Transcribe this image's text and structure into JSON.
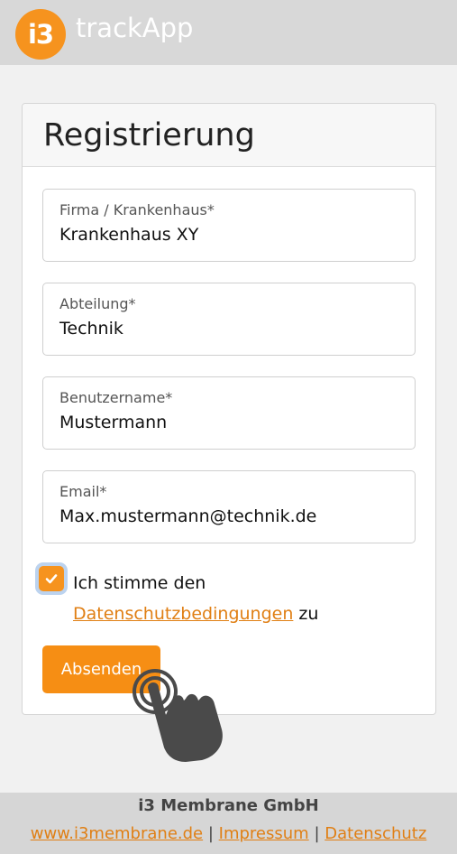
{
  "header": {
    "logo_text": "i3",
    "app_name": "trackApp"
  },
  "form": {
    "title": "Registrierung",
    "fields": [
      {
        "label": "Firma / Krankenhaus*",
        "value": "Krankenhaus XY"
      },
      {
        "label": "Abteilung*",
        "value": "Technik"
      },
      {
        "label": "Benutzername*",
        "value": "Mustermann"
      },
      {
        "label": "Email*",
        "value": "Max.mustermann@technik.de"
      }
    ],
    "consent": {
      "checked": true,
      "text_before": "Ich stimme den",
      "link_text": "Datenschutzbedingungen",
      "text_after": "zu"
    },
    "submit_label": "Absenden"
  },
  "footer": {
    "company": "i3 Membrane GmbH",
    "links": [
      "www.i3membrane.de",
      "Impressum",
      "Datenschutz"
    ],
    "separator": "|"
  },
  "colors": {
    "accent": "#f6931e",
    "header_bg": "#d8d8d8",
    "link": "#e07f14"
  },
  "icons": [
    "checkmark-icon",
    "tap-hand-icon"
  ]
}
